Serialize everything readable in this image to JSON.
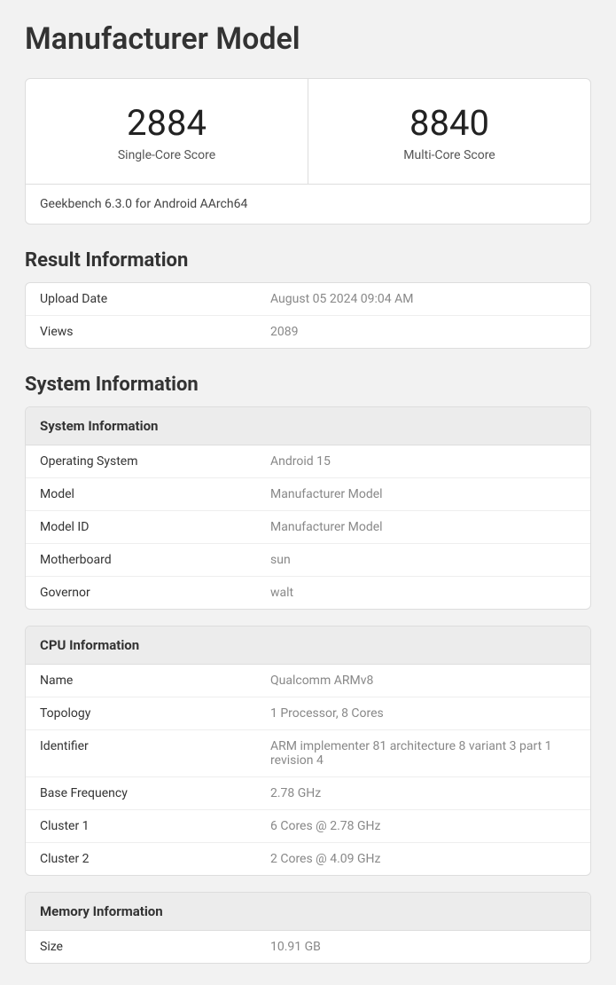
{
  "title": "Manufacturer Model",
  "scores": {
    "single": {
      "value": "2884",
      "label": "Single-Core Score"
    },
    "multi": {
      "value": "8840",
      "label": "Multi-Core Score"
    }
  },
  "benchmark_version": "Geekbench 6.3.0 for Android AArch64",
  "sections": {
    "result_info": {
      "heading": "Result Information",
      "rows": [
        {
          "key": "Upload Date",
          "val": "August 05 2024 09:04 AM"
        },
        {
          "key": "Views",
          "val": "2089"
        }
      ]
    },
    "system_info": {
      "heading": "System Information",
      "header": "System Information",
      "rows": [
        {
          "key": "Operating System",
          "val": "Android 15"
        },
        {
          "key": "Model",
          "val": "Manufacturer Model"
        },
        {
          "key": "Model ID",
          "val": "Manufacturer Model"
        },
        {
          "key": "Motherboard",
          "val": "sun"
        },
        {
          "key": "Governor",
          "val": "walt"
        }
      ]
    },
    "cpu_info": {
      "header": "CPU Information",
      "rows": [
        {
          "key": "Name",
          "val": "Qualcomm ARMv8"
        },
        {
          "key": "Topology",
          "val": "1 Processor, 8 Cores"
        },
        {
          "key": "Identifier",
          "val": "ARM implementer 81 architecture 8 variant 3 part 1 revision 4"
        },
        {
          "key": "Base Frequency",
          "val": "2.78 GHz"
        },
        {
          "key": "Cluster 1",
          "val": "6 Cores @ 2.78 GHz"
        },
        {
          "key": "Cluster 2",
          "val": "2 Cores @ 4.09 GHz"
        }
      ]
    },
    "memory_info": {
      "header": "Memory Information",
      "rows": [
        {
          "key": "Size",
          "val": "10.91 GB"
        }
      ]
    }
  }
}
